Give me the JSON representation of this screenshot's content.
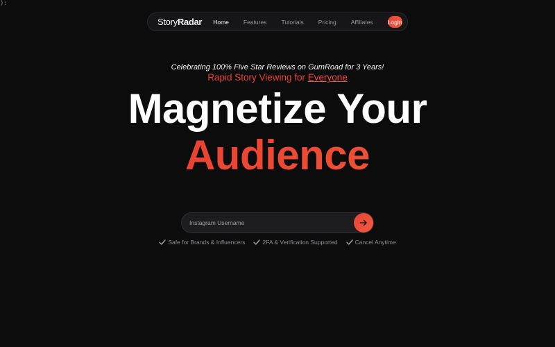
{
  "stray_text": "):",
  "nav": {
    "logo_part1": "Story",
    "logo_part2": "Radar",
    "links": [
      {
        "label": "Home",
        "active": true
      },
      {
        "label": "Features",
        "active": false
      },
      {
        "label": "Tutorials",
        "active": false
      },
      {
        "label": "Pricing",
        "active": false
      },
      {
        "label": "Affiliates",
        "active": false
      }
    ],
    "login_label": "Login"
  },
  "hero": {
    "tagline": "Celebrating 100% Five Star Reviews on GumRoad for 3 Years!",
    "subtitle_prefix": "Rapid Story Viewing for ",
    "subtitle_link": "Everyone",
    "headline_line1": "Magnetize Your",
    "headline_line2": "Audience"
  },
  "search": {
    "placeholder": "Instagram Username",
    "submit_icon": "arrow-right-icon"
  },
  "features": [
    {
      "icon": "check-icon",
      "label": "Safe for Brands & Influencers"
    },
    {
      "icon": "check-icon",
      "label": "2FA & Verification Supported"
    },
    {
      "icon": "check-icon",
      "label": "Cancel Anytime"
    }
  ],
  "colors": {
    "accent": "#e8443a",
    "background": "#0d0c0d"
  }
}
